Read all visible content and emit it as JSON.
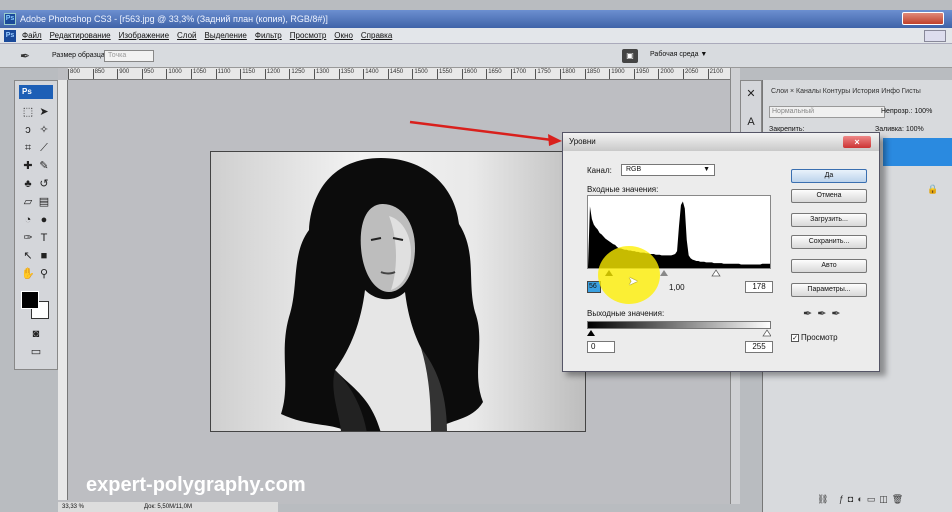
{
  "window": {
    "title": "Adobe Photoshop CS3 - [r563.jpg @ 33,3% (Задний план (копия), RGB/8#)]"
  },
  "menu": {
    "items": [
      "Файл",
      "Редактирование",
      "Изображение",
      "Слой",
      "Выделение",
      "Фильтр",
      "Просмотр",
      "Окно",
      "Справка"
    ]
  },
  "options": {
    "size_label": "Размер образца:",
    "size_value": "Точка",
    "workspace": "Рабочая среда ▼"
  },
  "toolbox": {
    "badge": "Ps"
  },
  "ruler": {
    "ticks": [
      "800",
      "850",
      "900",
      "950",
      "1000",
      "1050",
      "1100",
      "1150",
      "1200",
      "1250",
      "1300",
      "1350",
      "1400",
      "1450",
      "1500",
      "1550",
      "1600",
      "1650",
      "1700",
      "1750",
      "1800",
      "1850",
      "1900",
      "1950",
      "2000",
      "2050",
      "2100"
    ]
  },
  "status": {
    "zoom": "33,33 %",
    "doc": "Док: 5,50M/11,0M"
  },
  "watermark": "expert-polygraphy.com",
  "panels": {
    "tabs": "Слои ×  Каналы  Контуры  История  Инфо  Гисты",
    "blend": "Нормальный",
    "opacity": "Непрозр.: 100%",
    "lock": "Закрепить:",
    "fill": "Заливка: 100%"
  },
  "levels": {
    "title": "Уровни",
    "channel_label": "Канал:",
    "channel_value": "RGB",
    "input_label": "Входные значения:",
    "input_black": "56",
    "input_gamma": "1,00",
    "input_white": "178",
    "output_label": "Выходные значения:",
    "output_black": "0",
    "output_white": "255",
    "buttons": {
      "ok": "Да",
      "cancel": "Отмена",
      "load": "Загрузить...",
      "save": "Сохранить...",
      "auto": "Авто",
      "options": "Параметры..."
    },
    "preview_label": "Просмотр",
    "histogram": [
      2,
      88,
      70,
      62,
      58,
      55,
      50,
      48,
      45,
      42,
      40,
      38,
      36,
      34,
      33,
      30,
      28,
      28,
      27,
      26,
      26,
      25,
      25,
      24,
      24,
      23,
      23,
      22,
      22,
      22,
      21,
      21,
      20,
      20,
      20,
      19,
      19,
      19,
      18,
      18,
      18,
      18,
      18,
      18,
      19,
      20,
      24,
      60,
      90,
      95,
      85,
      40,
      18,
      14,
      12,
      11,
      10,
      10,
      9,
      9,
      9,
      8,
      8,
      8,
      8,
      7,
      7,
      7,
      7,
      7,
      6,
      6,
      6,
      6,
      6,
      6,
      6,
      6,
      6,
      5,
      5,
      5,
      5,
      5,
      5,
      5,
      5,
      5,
      5,
      5,
      6,
      6,
      6,
      6,
      6
    ]
  }
}
